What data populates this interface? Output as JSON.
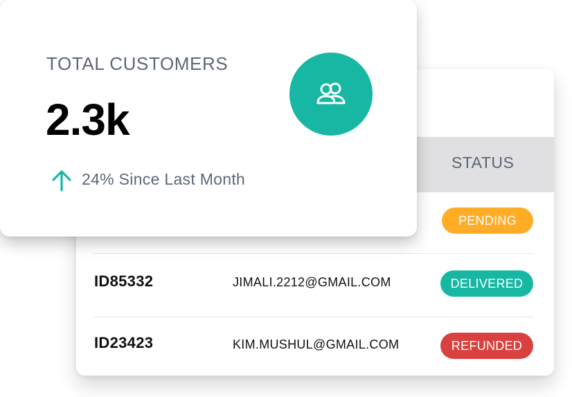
{
  "colors": {
    "accent": "#17b7a3",
    "pending": "#ffac27",
    "delivered": "#17b7a3",
    "refunded": "#d9413f",
    "muted_text": "#5d6777"
  },
  "stat_card": {
    "title": "TOTAL CUSTOMERS",
    "value": "2.3k",
    "trend_icon": "arrow-up-icon",
    "trend_text": "24% Since Last Month",
    "icon": "users-icon"
  },
  "orders_table": {
    "status_header": "STATUS",
    "rows": [
      {
        "id": "",
        "email": "",
        "status": "PENDING"
      },
      {
        "id": "ID85332",
        "email": "JIMALI.2212@GMAIL.COM",
        "status": "DELIVERED"
      },
      {
        "id": "ID23423",
        "email": "KIM.MUSHUL@GMAIL.COM",
        "status": "REFUNDED"
      }
    ]
  }
}
